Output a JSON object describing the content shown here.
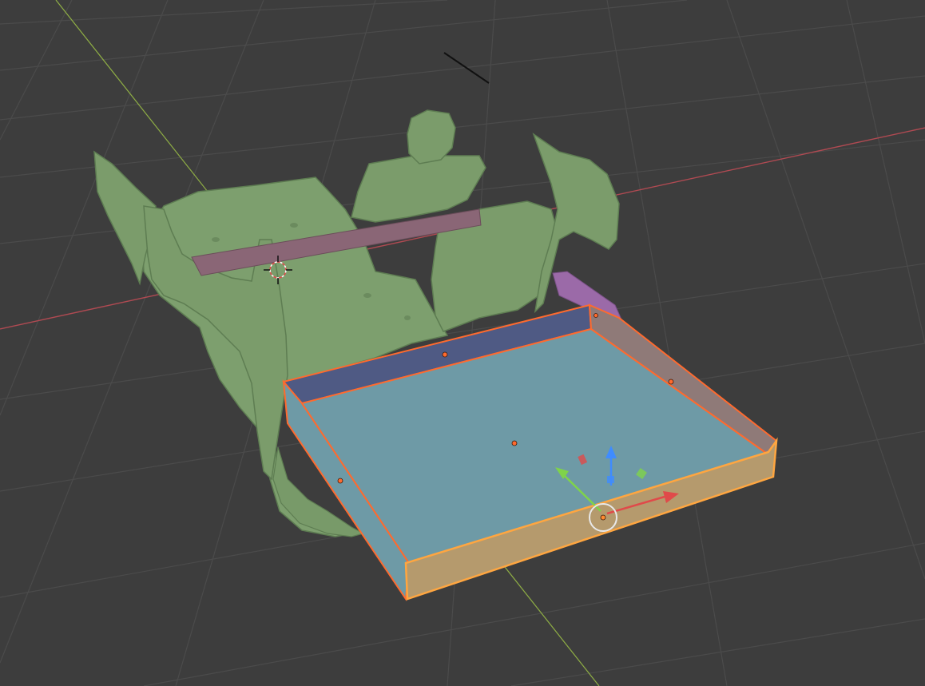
{
  "viewport": {
    "background": "#3d3d3d",
    "grid_color": "#4b4b4b",
    "x_axis_color": "#b04a52",
    "y_axis_color": "#8fae45"
  },
  "scene": {
    "scan_mesh_color": "#7d9f6e",
    "panel_color": "#8a6676",
    "side_panel_color": "#9b6aa8",
    "tray_floor_color": "#6e9aa6",
    "tray_back_wall_color": "#4f5a84",
    "tray_front_wall_color": "#b59a6d",
    "selection_outline_color": "#ff6a2e",
    "active_outline_color": "#ffa640"
  },
  "gizmo": {
    "x_color": "#e04a4a",
    "y_color": "#7fd34a",
    "z_color": "#3f8cff",
    "icons": [
      "move-x-arrow-icon",
      "move-y-arrow-icon",
      "move-z-arrow-icon",
      "plane-xy-handle-icon",
      "plane-yz-handle-icon",
      "plane-xz-handle-icon",
      "view-center-circle-icon"
    ]
  },
  "cursor_icon": "3d-cursor-icon"
}
